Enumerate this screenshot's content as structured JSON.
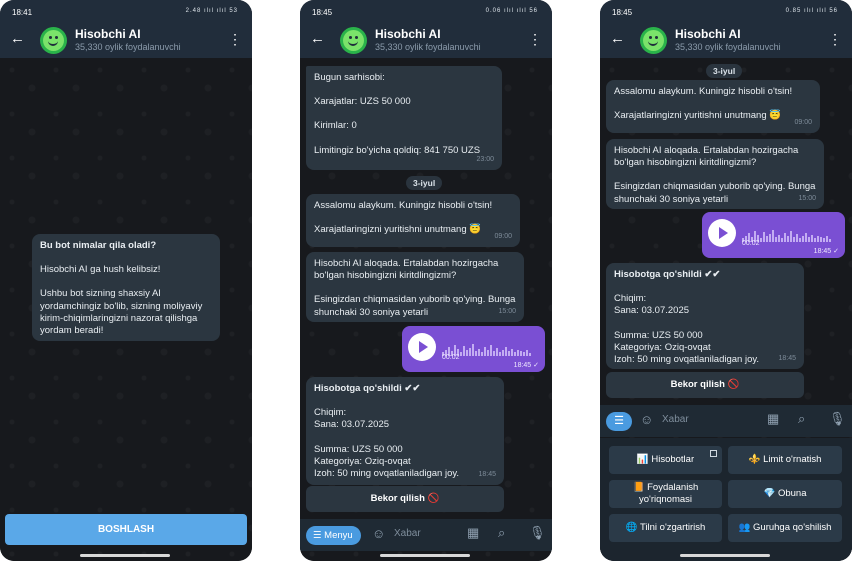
{
  "phone1": {
    "status_time": "18:41",
    "status_icons": "2.48 ılıl ılıl 53",
    "title": "Hisobchi AI",
    "subtitle": "35,330 oylik foydalanuvchi",
    "intro_lines": [
      "Bu bot nimalar qila oladi?",
      "Hisobchi AI ga hush kelibsiz!",
      "Ushbu bot sizning shaxsiy AI yordamchingiz bo'lib, sizning moliyaviy kirim-chiqimlaringizni nazorat qilishga yordam beradi!"
    ],
    "start_button": "BOSHLASH"
  },
  "phone2": {
    "status_time": "18:45",
    "status_icons": "0.06 ılıl ılıl 56",
    "title": "Hisobchi AI",
    "subtitle": "35,330 oylik foydalanuvchi",
    "summary": {
      "l1": "Bugun sarhisobi:",
      "l2": "Xarajatlar: UZS 50 000",
      "l3": "Kirimlar: 0",
      "l4": "Limitingiz bo'yicha qoldiq: 841 750 UZS",
      "time": "23:00"
    },
    "date_pill": "3-iyul",
    "greeting": {
      "l1": "Assalomu alaykum. Kuningiz hisobli o'tsin!",
      "l2": "Xarajatlaringizni yuritishni unutmang 😇",
      "time": "09:00"
    },
    "connect": {
      "l1": "Hisobchi AI aloqada. Ertalabdan hozirgacha bo'lgan hisobingizni kiritdlingizmi?",
      "l2": "Esingizdan chiqmasidan yuborib qo'ying. Bunga shunchaki 30 soniya yetarli",
      "time": "15:00"
    },
    "voice": {
      "duration": "00:02",
      "time": "18:45 ✓"
    },
    "saved": {
      "header": "Hisobotga qo'shildi ✔✔",
      "l1": "Chiqim:",
      "l2": "Sana: 03.07.2025",
      "l3": "Summa: UZS 50 000",
      "l4": "Kategoriya: Oziq-ovqat",
      "l5": "Izoh: 50 ming ovqatlaniladigan joy.",
      "time": "18:45"
    },
    "cancel_button": "Bekor qilish 🚫",
    "input": {
      "menu_label": "Menyu",
      "placeholder": "Xabar"
    }
  },
  "phone3": {
    "status_time": "18:45",
    "status_icons": "0.85 ılıl ılıl 56",
    "title": "Hisobchi AI",
    "subtitle": "35,330 oylik foydalanuvchi",
    "date_pill": "3-iyul",
    "greeting": {
      "l1": "Assalomu alaykum. Kuningiz hisobli o'tsin!",
      "l2": "Xarajatlaringizni yuritishni unutmang 😇",
      "time": "09:00"
    },
    "connect": {
      "l1": "Hisobchi AI aloqada. Ertalabdan hozirgacha bo'lgan hisobingizni kiritdlingizmi?",
      "l2": "Esingizdan chiqmasidan yuborib qo'ying. Bunga shunchaki 30 soniya yetarli",
      "time": "15:00"
    },
    "voice": {
      "duration": "00:02",
      "time": "18:45 ✓"
    },
    "saved": {
      "header": "Hisobotga qo'shildi ✔✔",
      "l1": "Chiqim:",
      "l2": "Sana: 03.07.2025",
      "l3": "Summa: UZS 50 000",
      "l4": "Kategoriya: Oziq-ovqat",
      "l5": "Izoh: 50 ming ovqatlaniladigan joy.",
      "time": "18:45"
    },
    "cancel_button": "Bekor qilish 🚫",
    "input": {
      "placeholder": "Xabar"
    },
    "keyboard": {
      "hisobotlar": "📊 Hisobotlar",
      "limit": "⚜️ Limit o'rnatish",
      "guide": "📙 Foydalanish yo'riqnomasi",
      "obuna": "💎 Obuna",
      "lang": "🌐 Tilni o'zgartirish",
      "group": "👥 Guruhga qo'shilish"
    }
  },
  "colors": {
    "header": "#212d3b",
    "bubble": "#2b3640",
    "voice": "#7a4fd3",
    "accent": "#5aa8e8"
  },
  "icons": [
    "back-arrow-icon",
    "kebab-menu-icon",
    "play-icon",
    "emoji-icon",
    "sticker-icon",
    "paperclip-icon",
    "microphone-icon",
    "menu-icon"
  ]
}
